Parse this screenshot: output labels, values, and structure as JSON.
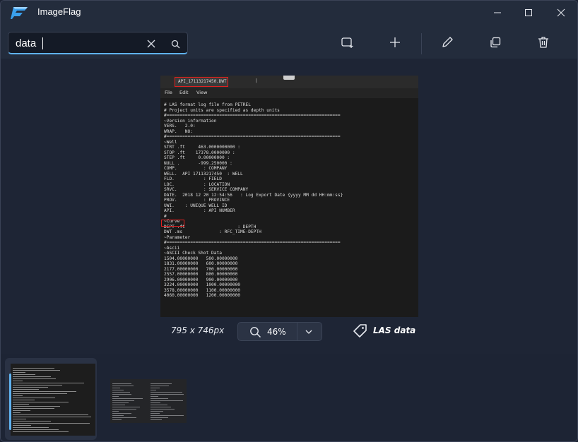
{
  "app": {
    "title": "ImageFlag"
  },
  "search": {
    "value": "data",
    "placeholder": ""
  },
  "toolbar": {
    "buttons": [
      "select-area-icon",
      "add-icon",
      "edit-icon",
      "copy-icon",
      "delete-icon"
    ]
  },
  "preview": {
    "tab_label": "API_17113217450.DWT.las",
    "tab_more": "|",
    "menu": [
      "File",
      "Edit",
      "View"
    ],
    "lines": [
      "# LAS format log file from PETREL",
      "# Project units are specified as depth units",
      "#==================================================================",
      "~Version information",
      "VERS.   2.0:",
      "WRAP.   NO:",
      "#==================================================================",
      "~Well",
      "STRT .ft     463.0000000000 :",
      "STOP .ft    17378.0000000 :",
      "STEP .ft     0.00000000 :",
      "NULL .       -999.250000 :",
      "COMP.          : COMPANY",
      "WELL.  API 17113217450  : WELL",
      "FLD.           : FIELD",
      "LOC.           : LOCATION",
      "SRVC.          : SERVICE COMPANY",
      "DATE.  2018 12 20 12:54:56   : Log Export Date {yyyy MM dd HH:mm:ss}",
      "PROV.          : PROVINCE",
      "UWI.    : UNIQUE WELL ID",
      "API.           : API NUMBER",
      "#",
      "~Curve",
      "DEPT .ft                    : DEPTH",
      "DWT .ms              : RFC_TIME-DEPTH",
      "~Parameter",
      "#==================================================================",
      "~Ascii",
      "~ASCII Check Shot Data",
      "1504.00000000   500.00000000",
      "1831.00000000   600.00000000",
      "2177.00000000   700.00000000",
      "2557.00000000   800.00000000",
      "2906.00000000   900.00000000",
      "3224.00000000   1000.00000000",
      "3578.00000000   1100.00000000",
      "4060.00000000   1200.00000000"
    ]
  },
  "info": {
    "dimensions": "795 x 746px",
    "zoom": "46%",
    "tag": "LAS data"
  },
  "filmstrip": {
    "selected_index": 0,
    "count": 2
  },
  "colors": {
    "accent": "#5fb2f0",
    "highlight_box": "#e02020",
    "window_bg": "#1e2636"
  }
}
